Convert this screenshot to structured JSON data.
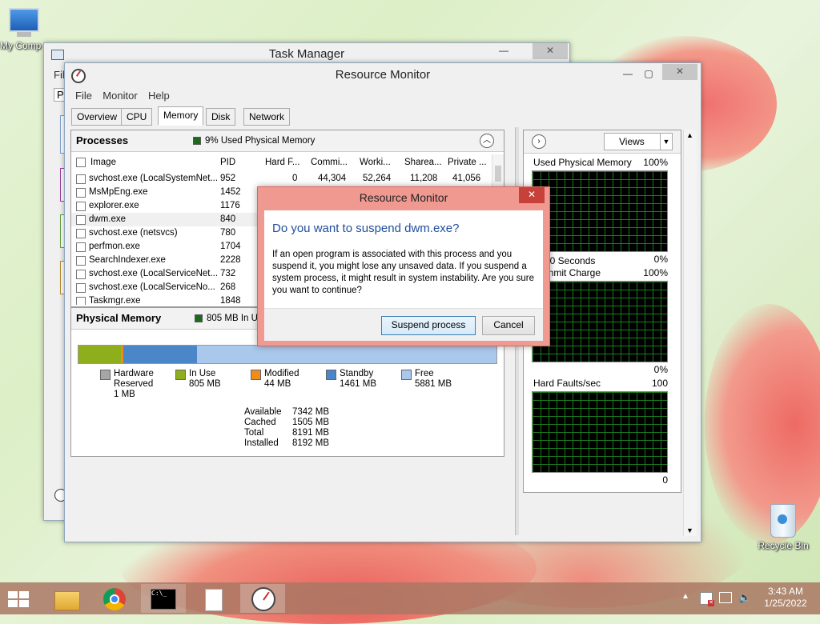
{
  "desktop": {
    "icons": [
      {
        "label": "My Comp",
        "icon": "computer-icon"
      },
      {
        "label": "Recycle Bin",
        "icon": "recycle-bin-icon"
      }
    ]
  },
  "task_manager": {
    "title": "Task Manager",
    "menu_first": "Fil",
    "tab_first": "Pr"
  },
  "resmon": {
    "title": "Resource Monitor",
    "menu": [
      "File",
      "Monitor",
      "Help"
    ],
    "tabs": [
      "Overview",
      "CPU",
      "Memory",
      "Disk",
      "Network"
    ],
    "active_tab": "Memory",
    "processes": {
      "title": "Processes",
      "badge": "9% Used Physical Memory",
      "columns": [
        "Image",
        "PID",
        "Hard F...",
        "Commi...",
        "Worki...",
        "Sharea...",
        "Private ..."
      ],
      "rows": [
        {
          "image": "svchost.exe (LocalSystemNet...",
          "pid": "952",
          "hard": "0",
          "commit": "44,304",
          "working": "52,264",
          "share": "11,208",
          "private": "41,056"
        },
        {
          "image": "MsMpEng.exe",
          "pid": "1452"
        },
        {
          "image": "explorer.exe",
          "pid": "1176"
        },
        {
          "image": "dwm.exe",
          "pid": "840"
        },
        {
          "image": "svchost.exe (netsvcs)",
          "pid": "780"
        },
        {
          "image": "perfmon.exe",
          "pid": "1704"
        },
        {
          "image": "SearchIndexer.exe",
          "pid": "2228"
        },
        {
          "image": "svchost.exe (LocalServiceNet...",
          "pid": "732"
        },
        {
          "image": "svchost.exe (LocalServiceNo...",
          "pid": "268"
        },
        {
          "image": "Taskmgr.exe",
          "pid": "1848"
        }
      ]
    },
    "physical": {
      "title": "Physical Memory",
      "badge": "805 MB In Use",
      "legend": [
        {
          "name": "Hardware Reserved",
          "line1": "Hardware",
          "line2": "Reserved",
          "value": "1 MB",
          "color": "#a6a6a6"
        },
        {
          "name": "In Use",
          "line1": "In Use",
          "line2": "",
          "value": "805 MB",
          "color": "#8fae1b"
        },
        {
          "name": "Modified",
          "line1": "Modified",
          "line2": "",
          "value": "44 MB",
          "color": "#f08c1a"
        },
        {
          "name": "Standby",
          "line1": "Standby",
          "line2": "",
          "value": "1461 MB",
          "color": "#4a86c8"
        },
        {
          "name": "Free",
          "line1": "Free",
          "line2": "",
          "value": "5881 MB",
          "color": "#a9c8ec"
        }
      ],
      "stats": [
        {
          "label": "Available",
          "value": "7342 MB"
        },
        {
          "label": "Cached",
          "value": "1505 MB"
        },
        {
          "label": "Total",
          "value": "8191 MB"
        },
        {
          "label": "Installed",
          "value": "8192 MB"
        }
      ]
    },
    "graphs": {
      "views_label": "Views",
      "items": [
        {
          "title": "Used Physical Memory",
          "max": "100%",
          "bottom_left": "",
          "bottom_right": "0%"
        },
        {
          "title": "Commit Charge",
          "max": "100%",
          "bottom_left": "Seconds",
          "bottom_right": "0%"
        },
        {
          "title": "Hard Faults/sec",
          "max": "100",
          "bottom_left": "",
          "bottom_right": "0"
        }
      ],
      "seconds_label": "60 Seconds"
    }
  },
  "dialog": {
    "title": "Resource Monitor",
    "heading": "Do you want to suspend dwm.exe?",
    "body": "If an open program is associated with this process and you suspend it, you might lose any unsaved data. If you suspend a system process, it might result in system instability. Are you sure you want to continue?",
    "primary": "Suspend process",
    "secondary": "Cancel"
  },
  "taskbar": {
    "time": "3:43 AM",
    "date": "1/25/2022"
  },
  "colors": {
    "dialog_frame": "#e8847a",
    "dialog_title_bg": "#ef9990",
    "close_red": "#c7403a",
    "heading_blue": "#1f4e9e"
  }
}
